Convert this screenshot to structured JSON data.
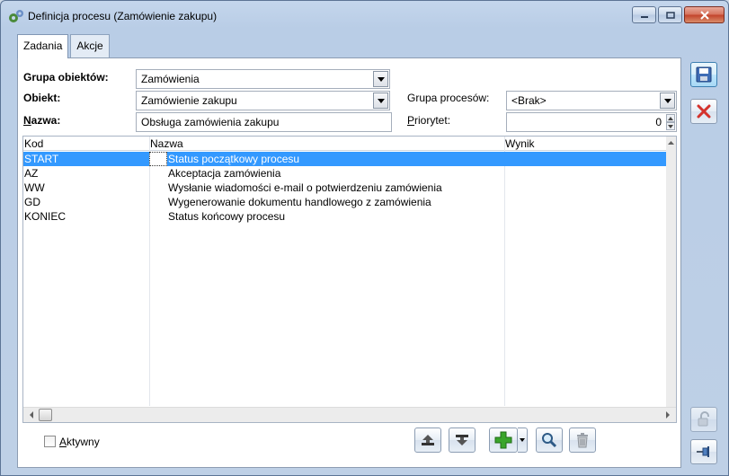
{
  "window": {
    "title": "Definicja procesu (Zamówienie zakupu)"
  },
  "tabs": [
    {
      "label": "Zadania"
    },
    {
      "label": "Akcje"
    }
  ],
  "form": {
    "grupa_obiektow_label": "Grupa obiektów:",
    "grupa_obiektow_value": "Zamówienia",
    "obiekt_label": "Obiekt:",
    "obiekt_value": "Zamówienie zakupu",
    "nazwa_label_first": "N",
    "nazwa_label_rest": "azwa:",
    "nazwa_value": "Obsługa zamówienia zakupu",
    "grupa_procesow_label": "Grupa procesów:",
    "grupa_procesow_value": "<Brak>",
    "priorytet_label_first": "P",
    "priorytet_label_rest": "riorytet:",
    "priorytet_value": "0"
  },
  "table": {
    "columns": {
      "kod": "Kod",
      "nazwa": "Nazwa",
      "wynik": "Wynik"
    },
    "rows": [
      {
        "kod": "START",
        "nazwa": "Status początkowy procesu",
        "wynik": ""
      },
      {
        "kod": "AZ",
        "nazwa": "Akceptacja zamówienia",
        "wynik": ""
      },
      {
        "kod": "WW",
        "nazwa": "Wysłanie wiadomości e-mail o potwierdzeniu zamówienia",
        "wynik": ""
      },
      {
        "kod": "GD",
        "nazwa": "Wygenerowanie dokumentu handlowego z zamówienia",
        "wynik": ""
      },
      {
        "kod": "KONIEC",
        "nazwa": "Status końcowy procesu",
        "wynik": ""
      }
    ],
    "selected_row": 0
  },
  "footer": {
    "aktywny_first": "A",
    "aktywny_rest": "ktywny",
    "aktywny_checked": false
  },
  "icons": {
    "save": "save-disk-icon",
    "cancel": "red-x-icon",
    "lock": "padlock-icon",
    "pin": "pin-icon",
    "move_up": "move-up-icon",
    "move_down": "move-down-icon",
    "add": "green-plus-icon",
    "search": "magnifier-icon",
    "delete": "trash-icon"
  },
  "colors": {
    "selection": "#3399ff",
    "add_green": "#3aa52b",
    "cancel_red": "#d4322c"
  }
}
